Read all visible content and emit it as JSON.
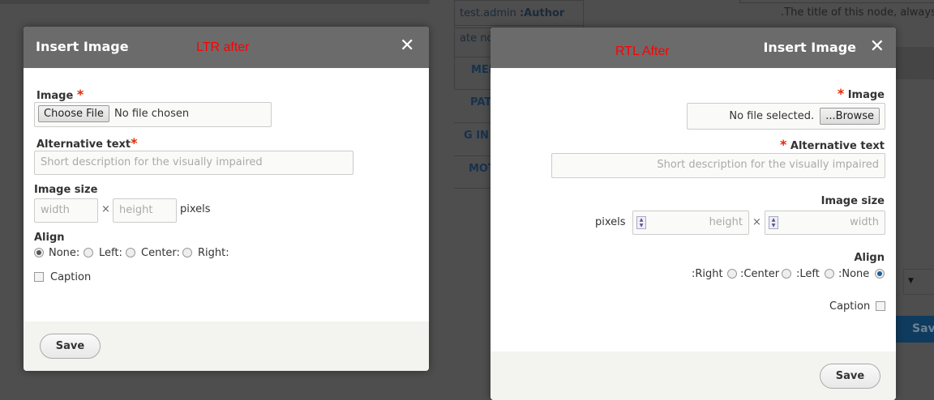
{
  "background": {
    "author_value": "test.admin",
    "author_label": ":Author",
    "row2": "ate no",
    "menu1": "MEN",
    "menu2": "PAT",
    "menu3": "G IN",
    "menu4": "MOTIC",
    "title_help": ".The title of this node, always trea",
    "save_label": "Save"
  },
  "ltr_dialog": {
    "title": "Insert Image",
    "annotation": "LTR after",
    "image_label": "Image",
    "required_mark": "*",
    "choose_file": "Choose File",
    "no_file": "No file chosen",
    "alt_label": "Alternative text",
    "alt_placeholder": "Short description for the visually impaired",
    "size_label": "Image size",
    "width_placeholder": "width",
    "times": "×",
    "height_placeholder": "height",
    "pixels": "pixels",
    "align_label": "Align",
    "align_options": [
      "None:",
      "Left:",
      "Center:",
      "Right:"
    ],
    "align_selected": "None",
    "caption": "Caption",
    "caption_checked": false,
    "save": "Save"
  },
  "rtl_dialog": {
    "title": "Insert Image",
    "annotation": "RTL After",
    "image_label": "Image",
    "required_mark": "*",
    "browse": "...Browse",
    "no_file": "No file selected.",
    "alt_label": "Alternative text",
    "alt_placeholder": "Short description for the visually impaired",
    "size_label": "Image size",
    "width_placeholder": "width",
    "times": "×",
    "height_placeholder": "height",
    "pixels": "pixels",
    "align_label": "Align",
    "align_options": [
      ":Right",
      ":Center",
      ":Left",
      ":None"
    ],
    "align_selected": "None",
    "caption": "Caption",
    "caption_checked": false,
    "save": "Save"
  }
}
